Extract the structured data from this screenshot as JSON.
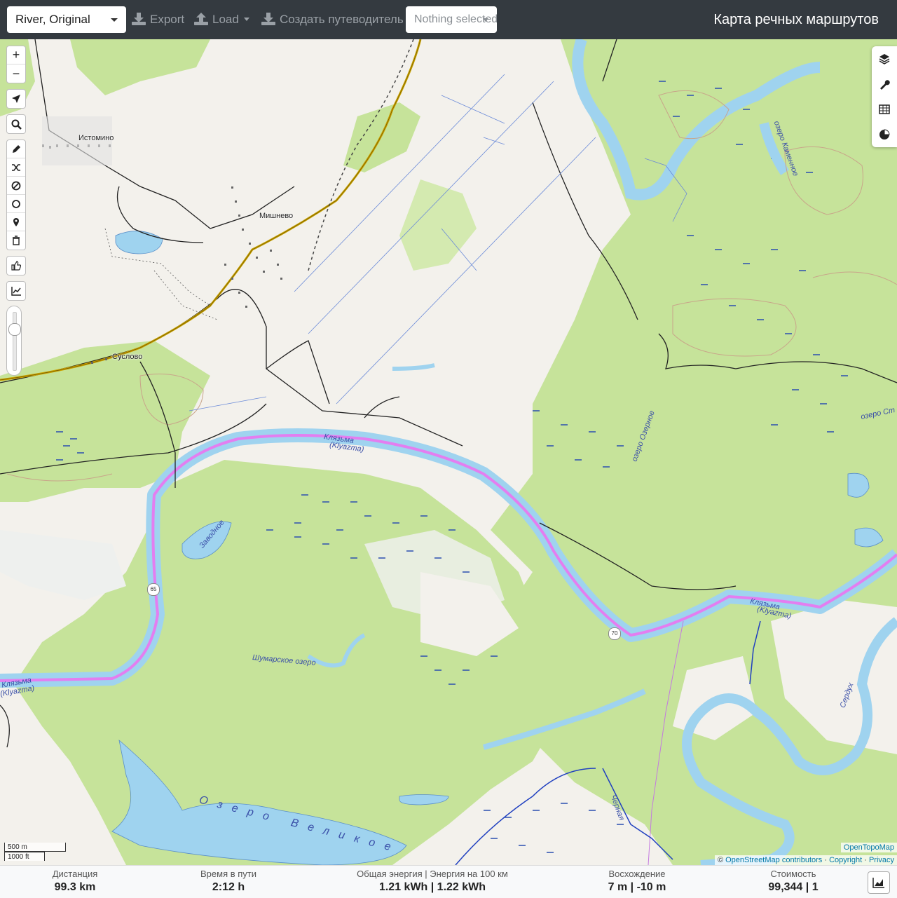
{
  "topbar": {
    "profile_value": "River, Original",
    "export_label": "Export",
    "load_label": "Load",
    "guide_label": "Создать путеводитель",
    "selection_placeholder": "Nothing selected",
    "app_title": "Карта речных маршрутов"
  },
  "map_labels": {
    "istomino": "Истомино",
    "mishnevo": "Мишнево",
    "suslovo": "Суслово",
    "klyazma_ru": "Клязьма",
    "klyazma_en": "(Klyazma)",
    "zavodnoe": "Заводное",
    "shumarskoe": "Шумарское озеро",
    "velikoe": "Озеро Великое",
    "kamennoe": "озеро Каменное",
    "ozero_st": "озеро Ст",
    "serduh": "Сердух",
    "chernaya": "Черная",
    "ozerodnoe": "озеро Озерное",
    "shield_65": "65",
    "shield_70": "70"
  },
  "controls": {
    "zoom_in": "+",
    "zoom_out": "−"
  },
  "scale": {
    "metric": "500 m",
    "imperial": "1000 ft"
  },
  "attribution": {
    "tiles": "OpenTopoMap",
    "prefix": "© ",
    "osm": "OpenStreetMap contributors",
    "sep1": " · ",
    "copyright": "Copyright",
    "sep2": " · ",
    "privacy": "Privacy"
  },
  "stats": {
    "distance_label": "Дистанция",
    "distance_value": "99.3 km",
    "time_label": "Время в пути",
    "time_value": "2:12 h",
    "energy_label": "Общая энергия | Энергия на 100 км",
    "energy_value": "1.21 kWh | 1.22 kWh",
    "ascent_label": "Восхождение",
    "ascent_value": "7 m | -10 m",
    "cost_label": "Стоимость",
    "cost_value": "99,344 | 1"
  },
  "colors": {
    "topbar": "#343a40",
    "forest": "#c6e39a",
    "water": "#9fd3ef",
    "route": "#e37ef0"
  }
}
